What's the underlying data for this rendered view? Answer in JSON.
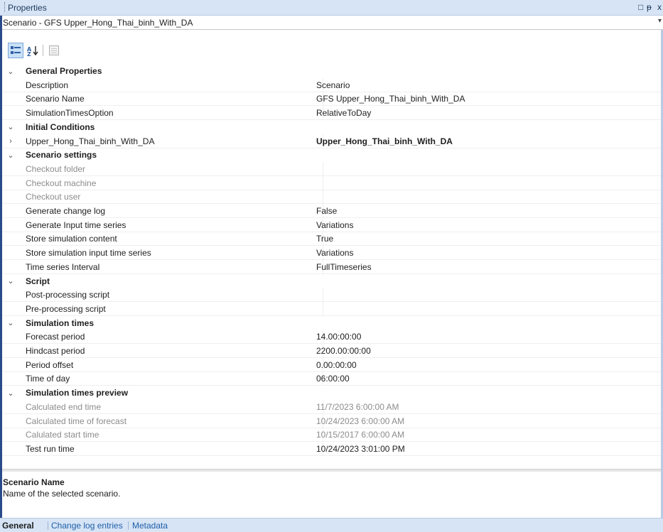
{
  "window": {
    "title": "Properties",
    "controls": [
      "□",
      "ᵽ",
      "x"
    ]
  },
  "selector": {
    "value": "Scenario - GFS Upper_Hong_Thai_binh_With_DA",
    "arrow": "▾"
  },
  "toolbar": {
    "categorized_icon": "categorized-view-icon",
    "alphabetical_icon": "sort-alphabetical-icon",
    "pages_icon": "property-pages-icon"
  },
  "grid": {
    "categories": [
      {
        "label": "General Properties",
        "rows": [
          {
            "name": "Description",
            "value": "Scenario"
          },
          {
            "name": "Scenario Name",
            "value": "GFS Upper_Hong_Thai_binh_With_DA"
          },
          {
            "name": "SimulationTimesOption",
            "value": "RelativeToDay"
          }
        ]
      },
      {
        "label": "Initial Conditions",
        "rows": [
          {
            "name": "Upper_Hong_Thai_binh_With_DA",
            "value": "Upper_Hong_Thai_binh_With_DA",
            "expandable": true,
            "bold_value": true
          }
        ]
      },
      {
        "label": "Scenario settings",
        "rows": [
          {
            "name": "Checkout folder",
            "value": "",
            "readonly": true
          },
          {
            "name": "Checkout machine",
            "value": "",
            "readonly": true
          },
          {
            "name": "Checkout user",
            "value": "",
            "readonly": true
          },
          {
            "name": "Generate change log",
            "value": "False"
          },
          {
            "name": "Generate Input time series",
            "value": "Variations"
          },
          {
            "name": "Store simulation content",
            "value": "True"
          },
          {
            "name": "Store simulation input time series",
            "value": "Variations"
          },
          {
            "name": "Time series Interval",
            "value": "FullTimeseries"
          }
        ]
      },
      {
        "label": "Script",
        "rows": [
          {
            "name": "Post-processing script",
            "value": ""
          },
          {
            "name": "Pre-processing script",
            "value": ""
          }
        ]
      },
      {
        "label": "Simulation times",
        "rows": [
          {
            "name": "Forecast period",
            "value": "14.00:00:00"
          },
          {
            "name": "Hindcast period",
            "value": "2200.00:00:00"
          },
          {
            "name": "Period offset",
            "value": "0.00:00:00"
          },
          {
            "name": "Time of day",
            "value": "06:00:00"
          }
        ]
      },
      {
        "label": "Simulation times preview",
        "rows": [
          {
            "name": "Calculated end time",
            "value": "11/7/2023 6:00:00 AM",
            "readonly": true
          },
          {
            "name": "Calculated time of forecast",
            "value": "10/24/2023 6:00:00 AM",
            "readonly": true
          },
          {
            "name": "Calulated start time",
            "value": "10/15/2017 6:00:00 AM",
            "readonly": true
          },
          {
            "name": "Test run time",
            "value": "10/24/2023 3:01:00 PM"
          }
        ]
      }
    ]
  },
  "description": {
    "title": "Scenario Name",
    "text": "Name of the selected scenario."
  },
  "tabs": [
    {
      "label": "General",
      "active": true
    },
    {
      "label": "Change log entries",
      "active": false
    },
    {
      "label": "Metadata",
      "active": false
    }
  ]
}
